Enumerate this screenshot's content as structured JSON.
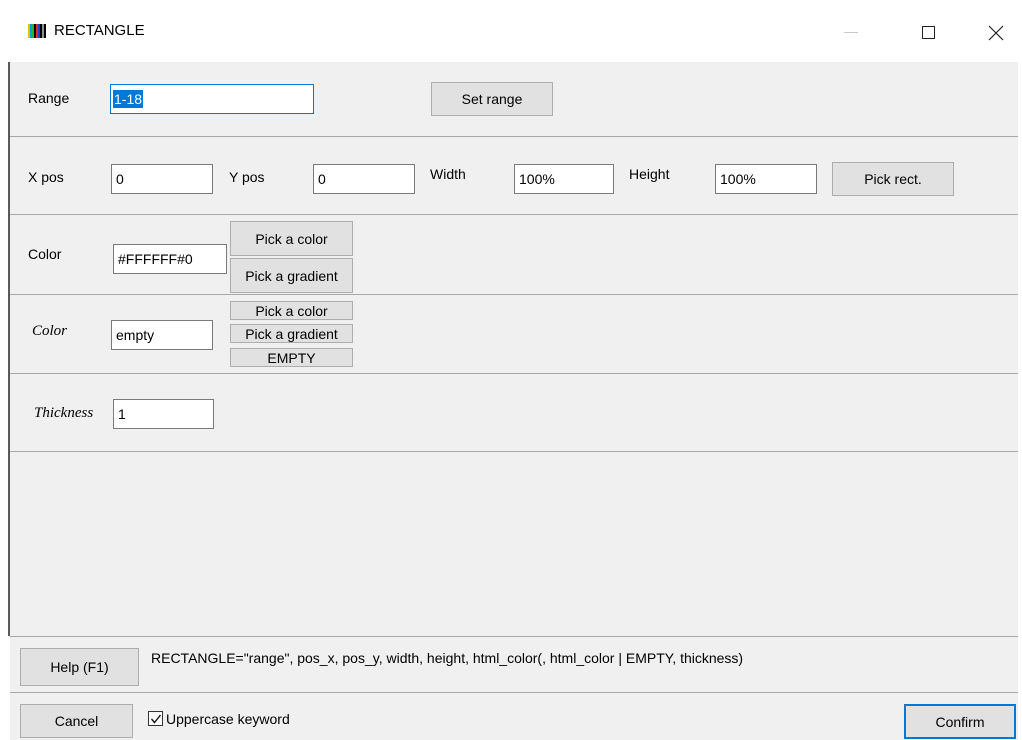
{
  "window": {
    "title": "RECTANGLE",
    "icon": "app-colorbars-icon"
  },
  "range": {
    "label": "Range",
    "value": "1-18",
    "set_button": "Set range"
  },
  "position": {
    "x_label": "X pos",
    "x_value": "0",
    "y_label": "Y pos",
    "y_value": "0",
    "width_label": "Width",
    "width_value": "100%",
    "height_label": "Height",
    "height_value": "100%",
    "pick_button": "Pick rect."
  },
  "fill_color": {
    "label": "Color",
    "value": "#FFFFFF#0",
    "pick_color_button": "Pick a color",
    "pick_gradient_button": "Pick a gradient"
  },
  "border_color": {
    "label": "Color",
    "value": "empty",
    "pick_color_button": "Pick a color",
    "pick_gradient_button": "Pick a gradient",
    "empty_button": "EMPTY"
  },
  "thickness": {
    "label": "Thickness",
    "value": "1"
  },
  "help": {
    "button": "Help (F1)",
    "syntax": "RECTANGLE=\"range\", pos_x, pos_y, width, height, html_color(, html_color | EMPTY, thickness)"
  },
  "footer": {
    "cancel_button": "Cancel",
    "uppercase_label": "Uppercase keyword",
    "uppercase_checked": true,
    "confirm_button": "Confirm"
  }
}
